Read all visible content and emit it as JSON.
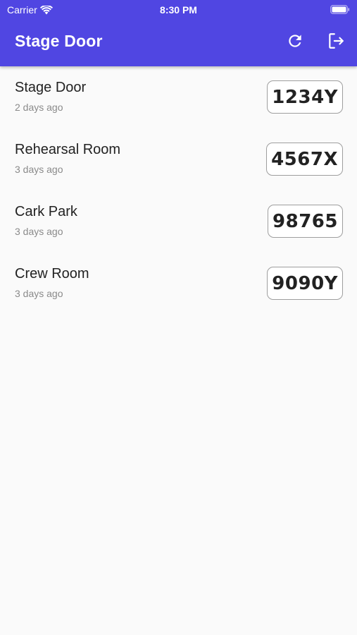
{
  "status_bar": {
    "carrier": "Carrier",
    "time": "8:30 PM"
  },
  "app_bar": {
    "title": "Stage Door",
    "actions": [
      "refresh-icon",
      "logout-icon"
    ],
    "background": "#5046e2"
  },
  "doors": [
    {
      "name": "Stage Door",
      "updated": "2 days ago",
      "code": "1234Y"
    },
    {
      "name": "Rehearsal Room",
      "updated": "3 days ago",
      "code": "4567X"
    },
    {
      "name": "Cark Park",
      "updated": "3 days ago",
      "code": "98765"
    },
    {
      "name": "Crew Room",
      "updated": "3 days ago",
      "code": "9090Y"
    }
  ]
}
